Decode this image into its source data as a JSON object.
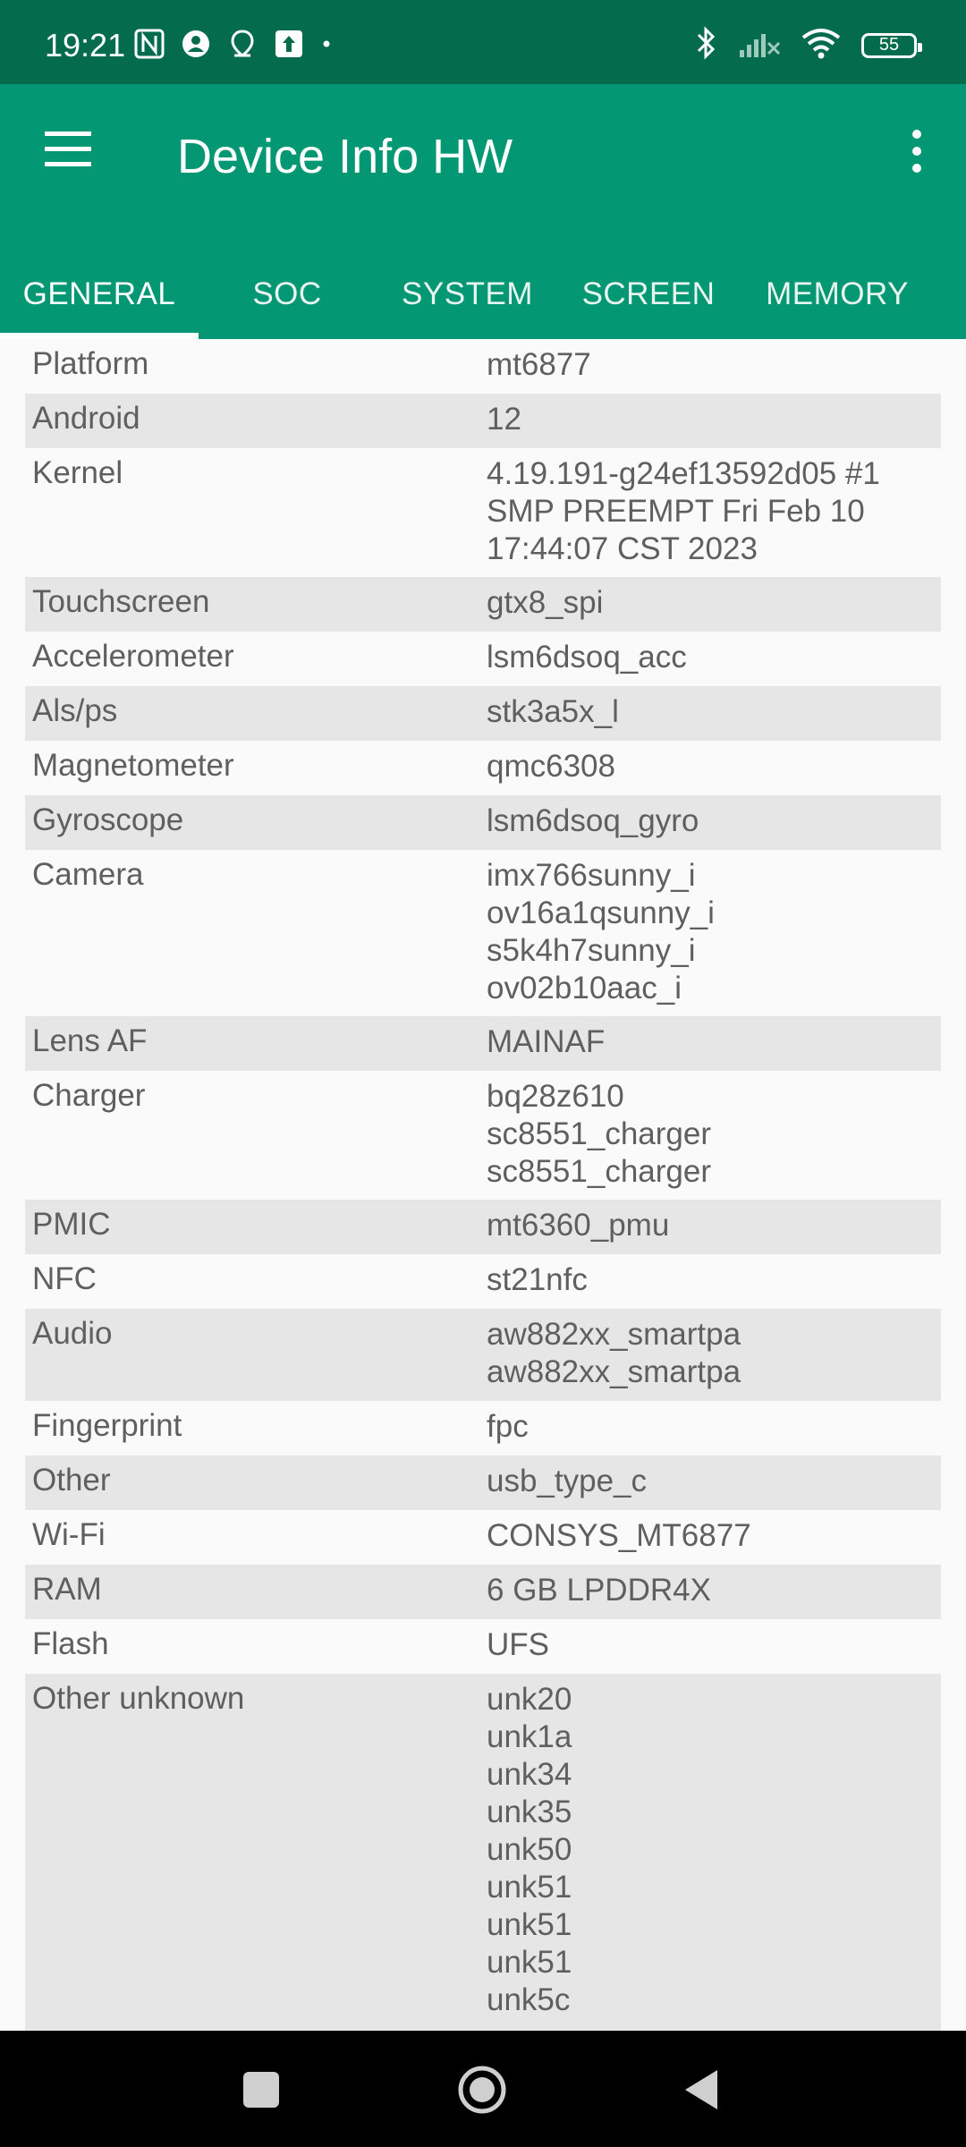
{
  "status_bar": {
    "time": "19:21",
    "battery": "55",
    "icons": [
      "nfc-icon",
      "account-icon",
      "location-icon",
      "upload-icon",
      "dot-icon",
      "bluetooth-icon",
      "cell-signal-off-icon",
      "wifi-icon",
      "battery-icon"
    ]
  },
  "app_bar": {
    "title": "Device Info HW",
    "menu_icon": "hamburger-menu-icon",
    "more_icon": "more-vert-icon",
    "color": "#049773",
    "status_color": "#046b4d"
  },
  "tabs": [
    {
      "label": "GENERAL",
      "active": true
    },
    {
      "label": "SOC",
      "active": false
    },
    {
      "label": "SYSTEM",
      "active": false
    },
    {
      "label": "SCREEN",
      "active": false
    },
    {
      "label": "MEMORY",
      "active": false
    }
  ],
  "rows": [
    {
      "label": "Platform",
      "value": "mt6877"
    },
    {
      "label": "Android",
      "value": "12"
    },
    {
      "label": "Kernel",
      "value": "4.19.191-g24ef13592d05 #1\nSMP PREEMPT Fri Feb 10\n17:44:07 CST 2023"
    },
    {
      "label": "Touchscreen",
      "value": "gtx8_spi"
    },
    {
      "label": "Accelerometer",
      "value": "lsm6dsoq_acc"
    },
    {
      "label": "Als/ps",
      "value": "stk3a5x_l"
    },
    {
      "label": "Magnetometer",
      "value": "qmc6308"
    },
    {
      "label": "Gyroscope",
      "value": "lsm6dsoq_gyro"
    },
    {
      "label": "Camera",
      "value": "imx766sunny_i\nov16a1qsunny_i\ns5k4h7sunny_i\nov02b10aac_i"
    },
    {
      "label": "Lens AF",
      "value": "MAINAF"
    },
    {
      "label": "Charger",
      "value": "bq28z610\nsc8551_charger\nsc8551_charger"
    },
    {
      "label": "PMIC",
      "value": "mt6360_pmu"
    },
    {
      "label": "NFC",
      "value": "st21nfc"
    },
    {
      "label": "Audio",
      "value": "aw882xx_smartpa\naw882xx_smartpa"
    },
    {
      "label": "Fingerprint",
      "value": "fpc"
    },
    {
      "label": "Other",
      "value": "usb_type_c"
    },
    {
      "label": "Wi-Fi",
      "value": "CONSYS_MT6877"
    },
    {
      "label": "RAM",
      "value": "6 GB LPDDR4X"
    },
    {
      "label": "Flash",
      "value": "UFS"
    },
    {
      "label": "Other unknown",
      "value": "unk20\nunk1a\nunk34\nunk35\nunk50\nunk51\nunk51\nunk51\nunk5c"
    }
  ],
  "nav_bar": {
    "buttons": [
      "recents-square-icon",
      "home-circle-icon",
      "back-triangle-icon"
    ]
  }
}
